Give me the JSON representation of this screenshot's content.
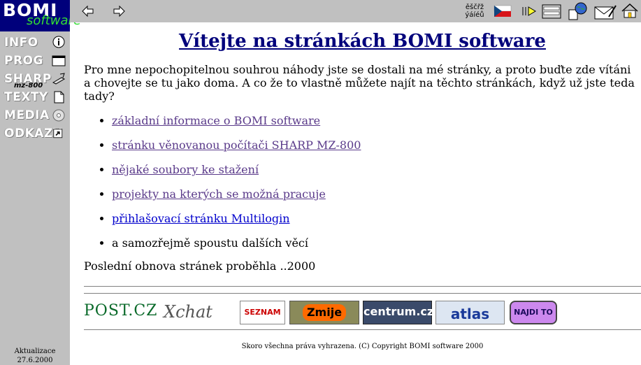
{
  "logo": {
    "line1": "BOMI",
    "line2": "software"
  },
  "sidebar": {
    "items": [
      {
        "label": "INFO",
        "icon": "info-icon"
      },
      {
        "label": "PROG",
        "icon": "window-icon"
      },
      {
        "label": "SHARP",
        "sub": "mz-800",
        "icon": "computer-icon"
      },
      {
        "label": "TEXTY",
        "icon": "document-icon"
      },
      {
        "label": "MEDIA",
        "icon": "cd-icon"
      },
      {
        "label": "ODKAZY",
        "icon": "shortcut-icon"
      }
    ],
    "update_label": "Aktualizace",
    "update_date": "27.6.2000"
  },
  "toolbar": {
    "back": "arrow-left-icon",
    "forward": "arrow-right-icon",
    "encoding_top": "ěščřž",
    "encoding_bottom": "ýáíéů",
    "flag": "czech-flag-icon",
    "buttons": [
      "play-icon",
      "frames-icon",
      "globe-icon",
      "mail-icon",
      "home-icon"
    ]
  },
  "main": {
    "title": "Vítejte na stránkách BOMI software",
    "intro": "Pro mne nepochopitelnou souhrou náhody jste se dostali na mé stránky, a proto buďte zde vítáni a chovejte se tu jako doma. A co že to vlastně můžete najít na těchto stránkách, když už jste teda tady?",
    "links": [
      "základní informace o BOMI software",
      "stránku věnovanou počítači SHARP MZ-800",
      "nějaké soubory ke stažení",
      "projekty na kterých se možná pracuje",
      "přihlašovací stránku Multilogin"
    ],
    "last_item": "a samozřejmě spoustu dalších věcí",
    "last_update": "Poslední obnova stránek proběhla ..2000"
  },
  "banners": [
    {
      "text": "POST.CZ"
    },
    {
      "text": "Xchat"
    },
    {
      "text": "SEZNAM"
    },
    {
      "text": "Zmije"
    },
    {
      "text": "centrum.cz"
    },
    {
      "text": "atlas"
    },
    {
      "text": "NAJDI TO"
    }
  ],
  "copyright": "Skoro všechna práva vyhrazena. (C) Copyright BOMI software 2000",
  "colors": {
    "sidebar": "#c0c0c0",
    "logo_bg": "#00007b",
    "title": "#00007b",
    "visited_link": "#5a3a8a",
    "link": "#0000cc"
  }
}
